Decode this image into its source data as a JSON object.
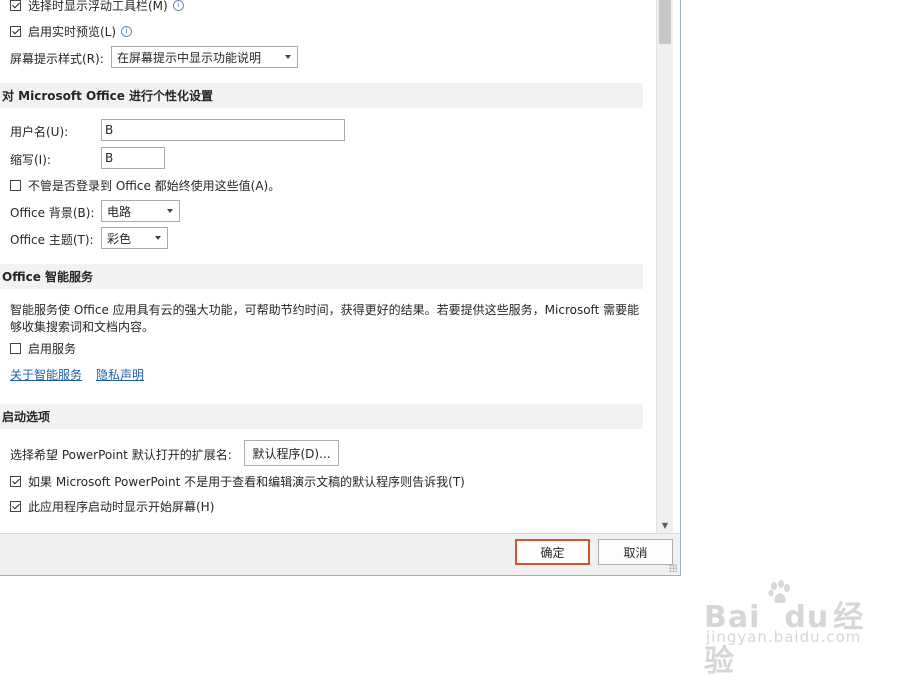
{
  "general": {
    "show_mini_toolbar": {
      "label": "选择时显示浮动工具栏(M)",
      "checked": true
    },
    "live_preview": {
      "label": "启用实时预览(L)",
      "checked": true
    },
    "screentip_style": {
      "label": "屏幕提示样式(R):",
      "value": "在屏幕提示中显示功能说明"
    }
  },
  "personalize": {
    "header": "对 Microsoft Office 进行个性化设置",
    "username_label": "用户名(U):",
    "username_value": "B",
    "initials_label": "缩写(I):",
    "initials_value": "B",
    "always_use": {
      "label": "不管是否登录到 Office 都始终使用这些值(A)。",
      "checked": false
    },
    "background_label": "Office 背景(B):",
    "background_value": "电路",
    "theme_label": "Office 主题(T):",
    "theme_value": "彩色"
  },
  "intelligent": {
    "header": "Office 智能服务",
    "desc_line1": "智能服务使 Office 应用具有云的强大功能，可帮助节约时间，获得更好的结果。若要提供这些服务，Microsoft 需要能",
    "desc_line2": "够收集搜索词和文档内容。",
    "enable": {
      "label": "启用服务",
      "checked": false
    },
    "about_link": "关于智能服务",
    "privacy_link": "隐私声明"
  },
  "startup": {
    "header": "启动选项",
    "ext_label": "选择希望 PowerPoint 默认打开的扩展名:",
    "default_programs_button": "默认程序(D)...",
    "tell_me": {
      "label": "如果 Microsoft PowerPoint 不是用于查看和编辑演示文稿的默认程序则告诉我(T)",
      "checked": true
    },
    "show_start": {
      "label": "此应用程序启动时显示开始屏幕(H)",
      "checked": true
    }
  },
  "footer": {
    "ok": "确定",
    "cancel": "取消"
  },
  "watermark": {
    "logo_a": "Bai",
    "logo_b": "du",
    "logo_c": "经验",
    "url": "jingyan.baidu.com"
  },
  "colors": {
    "accent": "#d35230",
    "link": "#1f5fa8",
    "section_bg": "#f2f2f2"
  }
}
